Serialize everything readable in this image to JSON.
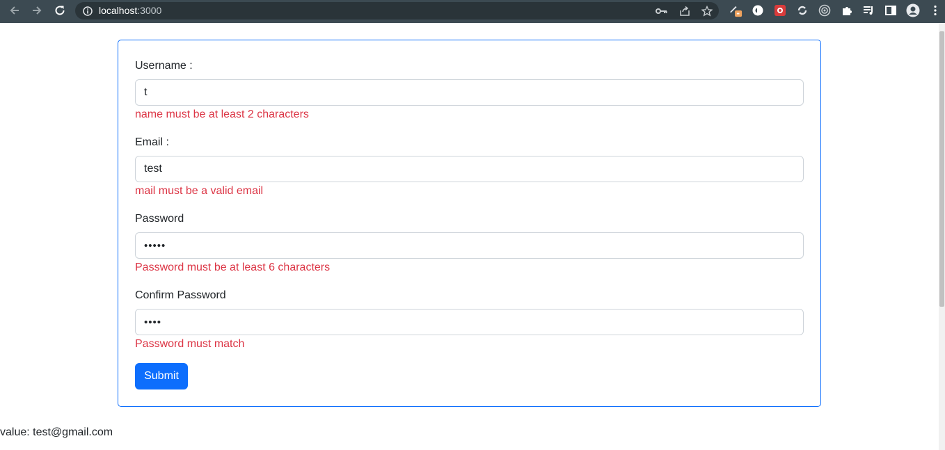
{
  "browser": {
    "url_host": "localhost",
    "url_port": ":3000",
    "toolbar_color": "#3c4a52"
  },
  "form": {
    "fields": [
      {
        "label": "Username :",
        "value": "t",
        "type": "text",
        "error": "name must be at least 2 characters"
      },
      {
        "label": "Email :",
        "value": "test",
        "type": "text",
        "error": "mail must be a valid email"
      },
      {
        "label": "Password",
        "value": "12345",
        "type": "password",
        "error": "Password must be at least 6 characters"
      },
      {
        "label": "Confirm Password",
        "value": "1234",
        "type": "password",
        "error": "Password must match"
      }
    ],
    "submit_label": "Submit",
    "accent_color": "#0d6efd",
    "error_color": "#dc3545"
  },
  "output": {
    "value_text": "value: test@gmail.com"
  }
}
